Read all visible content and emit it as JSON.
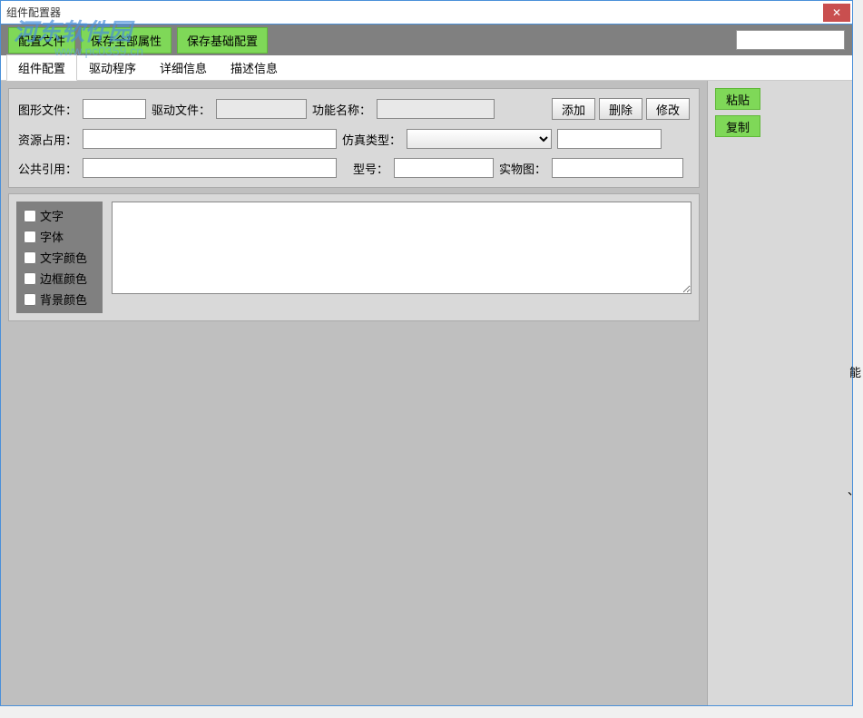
{
  "window": {
    "title": "组件配置器"
  },
  "watermark": {
    "text": "河东软件园",
    "url": "www.pc0359.cn"
  },
  "toolbar": {
    "config_file": "配置文件",
    "save_all_props": "保存全部属性",
    "save_base_config": "保存基础配置"
  },
  "tabs": {
    "items": [
      {
        "label": "组件配置",
        "active": true
      },
      {
        "label": "驱动程序",
        "active": false
      },
      {
        "label": "详细信息",
        "active": false
      },
      {
        "label": "描述信息",
        "active": false
      }
    ]
  },
  "form": {
    "labels": {
      "graphic_file": "图形文件：",
      "driver_file": "驱动文件：",
      "function_name": "功能名称：",
      "resource_usage": "资源占用：",
      "sim_type": "仿真类型：",
      "public_ref": "公共引用：",
      "model": "型号：",
      "physical_img": "实物图："
    },
    "values": {
      "graphic_file": "",
      "driver_file": "",
      "function_name": "",
      "resource_usage": "",
      "sim_type": "",
      "sim_extra": "",
      "public_ref": "",
      "model": "",
      "physical_img": ""
    },
    "buttons": {
      "add": "添加",
      "delete": "删除",
      "modify": "修改",
      "paste": "粘贴",
      "copy": "复制"
    }
  },
  "checkboxes": {
    "items": [
      {
        "label": "文字",
        "checked": false
      },
      {
        "label": "字体",
        "checked": false
      },
      {
        "label": "文字颜色",
        "checked": false
      },
      {
        "label": "边框颜色",
        "checked": false
      },
      {
        "label": "背景颜色",
        "checked": false
      }
    ]
  },
  "right_edge_chars": {
    "c1": "能",
    "c2": "、"
  }
}
